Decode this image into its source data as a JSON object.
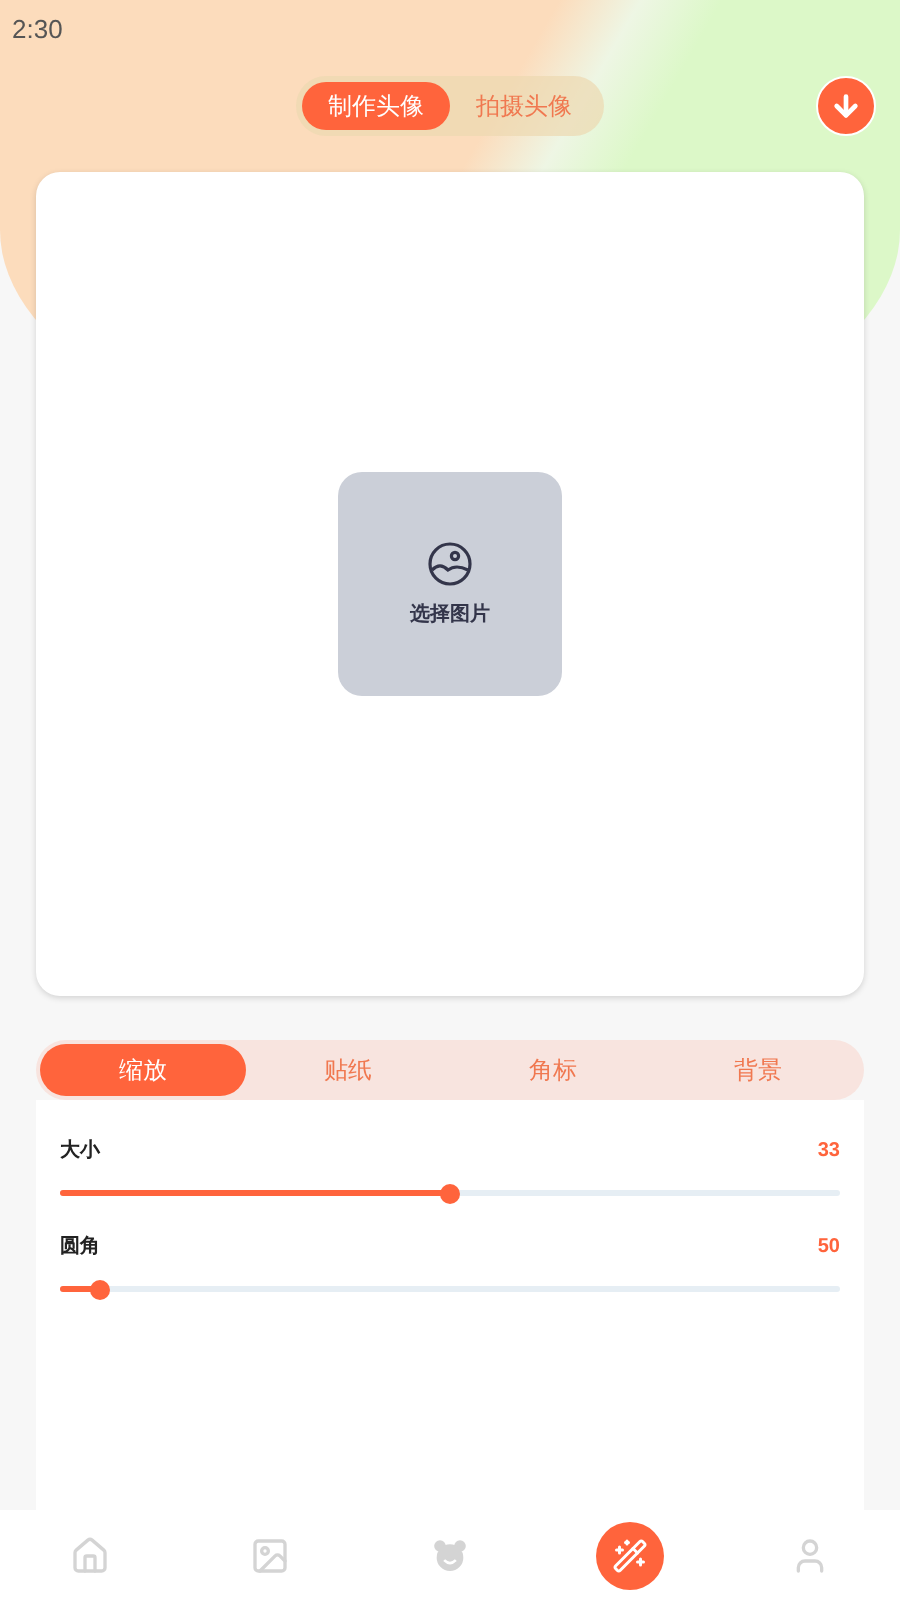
{
  "status_bar": {
    "time": "2:30"
  },
  "mode_tabs": [
    {
      "label": "制作头像",
      "selected": true
    },
    {
      "label": "拍摄头像",
      "selected": false
    }
  ],
  "canvas": {
    "picker_label": "选择图片"
  },
  "tool_tabs": [
    {
      "label": "缩放",
      "selected": true
    },
    {
      "label": "贴纸",
      "selected": false
    },
    {
      "label": "角标",
      "selected": false
    },
    {
      "label": "背景",
      "selected": false
    }
  ],
  "sliders": [
    {
      "label": "大小",
      "reading": "33",
      "level": 0.5
    },
    {
      "label": "圆角",
      "reading": "50",
      "level": 0.05
    }
  ],
  "bottom_nav": [
    {
      "kind": "home",
      "selected": false
    },
    {
      "kind": "gallery",
      "selected": false
    },
    {
      "kind": "bear",
      "selected": false
    },
    {
      "kind": "wand",
      "selected": true
    },
    {
      "kind": "user",
      "selected": false
    }
  ]
}
